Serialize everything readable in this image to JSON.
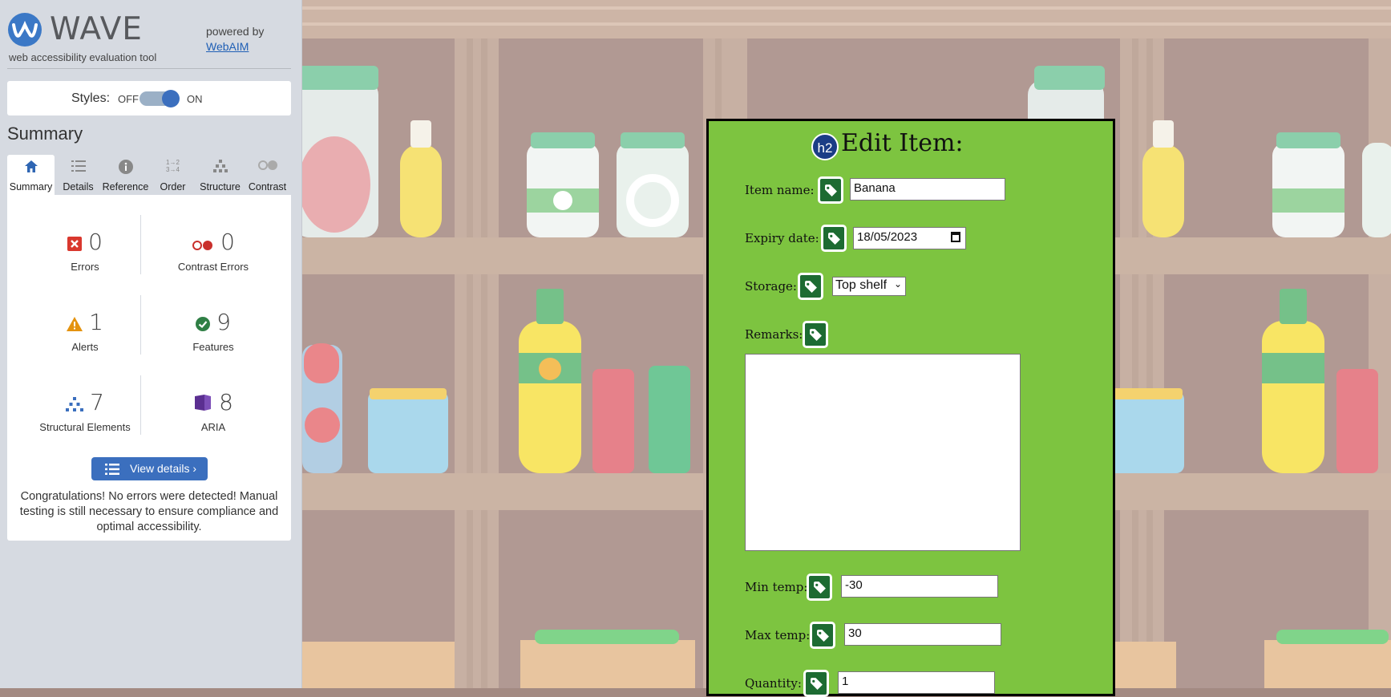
{
  "wave": {
    "title": "WAVE",
    "subtitle": "web accessibility evaluation tool",
    "powered_by": "powered by",
    "webaim_link": "WebAIM",
    "styles_label": "Styles:",
    "styles_off": "OFF",
    "styles_on": "ON",
    "styles_enabled": true,
    "summary_heading": "Summary",
    "tabs": [
      {
        "label": "Summary",
        "icon": "home-icon",
        "active": true
      },
      {
        "label": "Details",
        "icon": "list-icon",
        "active": false
      },
      {
        "label": "Reference",
        "icon": "info-icon",
        "active": false
      },
      {
        "label": "Order",
        "icon": "order-icon",
        "active": false
      },
      {
        "label": "Structure",
        "icon": "structure-icon",
        "active": false
      },
      {
        "label": "Contrast",
        "icon": "contrast-icon",
        "active": false
      }
    ],
    "stats": {
      "errors": {
        "count": "0",
        "label": "Errors",
        "color": "#d9382e"
      },
      "contrast_errors": {
        "count": "0",
        "label": "Contrast Errors",
        "color": "#c9302c"
      },
      "alerts": {
        "count": "1",
        "label": "Alerts",
        "color": "#e4930f"
      },
      "features": {
        "count": "9",
        "label": "Features",
        "color": "#2f7f45"
      },
      "structural": {
        "count": "7",
        "label": "Structural Elements",
        "color": "#3b6fbe"
      },
      "aria": {
        "count": "8",
        "label": "ARIA",
        "color": "#5b2f91"
      }
    },
    "view_details": "View details ›",
    "congrats": "Congratulations! No errors were detected! Manual testing is still necessary to ensure compliance and optimal accessibility."
  },
  "form": {
    "h2_badge": "h2",
    "title": "Edit Item:",
    "item_name_label": "Item name:",
    "item_name_value": "Banana",
    "expiry_label": "Expiry date:",
    "expiry_value": "18/05/2023",
    "storage_label": "Storage:",
    "storage_value": "Top shelf",
    "remarks_label": "Remarks:",
    "remarks_value": "",
    "min_temp_label": "Min temp:",
    "min_temp_value": "-30",
    "max_temp_label": "Max temp:",
    "max_temp_value": "30",
    "quantity_label": "Quantity:",
    "quantity_value": "1"
  },
  "colors": {
    "form_bg": "#7dc440",
    "wave_accent": "#3b6fbe",
    "tag_icon": "#1d6b32"
  }
}
